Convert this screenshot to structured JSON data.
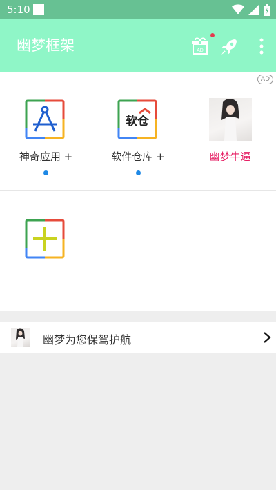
{
  "status_bar": {
    "time": "5:10"
  },
  "app_bar": {
    "title": "幽梦框架",
    "gift_ad_label": "AD",
    "colors": {
      "background": "#8ff6c7",
      "title": "#ffffff",
      "badge_dot": "#e5394e"
    }
  },
  "grid": {
    "ad_badge": "AD",
    "items": [
      {
        "label": "神奇应用 +",
        "icon": "compass-app-icon",
        "has_dot": true
      },
      {
        "label": "软件仓库 +",
        "icon": "software-repo-icon",
        "icon_text": "软仓",
        "has_dot": true
      },
      {
        "label": "幽梦牛逼",
        "icon": "girl-photo",
        "label_color": "#e61e63"
      },
      {
        "label": "",
        "icon": "add-icon"
      }
    ]
  },
  "bottom_row": {
    "text": "幽梦为您保驾护航"
  }
}
